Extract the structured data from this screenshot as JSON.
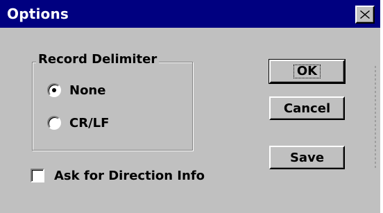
{
  "window": {
    "title": "Options",
    "close_icon": "close-icon"
  },
  "group": {
    "title": "Record Delimiter",
    "options": [
      {
        "label": "None",
        "selected": true
      },
      {
        "label": "CR/LF",
        "selected": false
      }
    ]
  },
  "checkbox": {
    "label": "Ask for Direction Info",
    "checked": false
  },
  "buttons": {
    "ok": "OK",
    "cancel": "Cancel",
    "save": "Save"
  },
  "colors": {
    "titlebar": "#000080",
    "face": "#c0c0c0"
  }
}
